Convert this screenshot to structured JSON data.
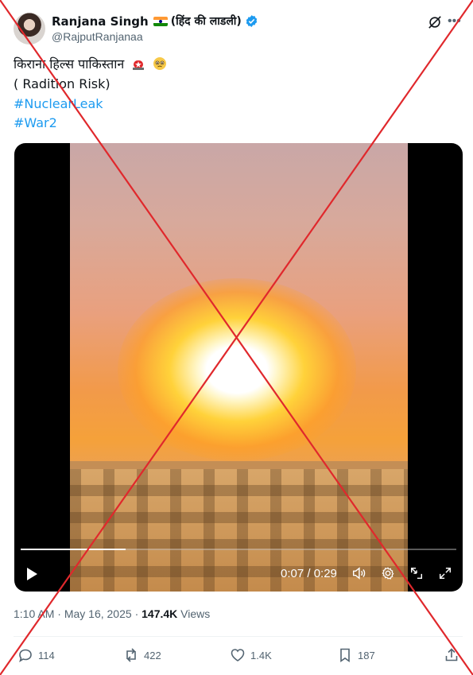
{
  "author": {
    "display_name": "Ranjana Singh",
    "name_suffix": "(हिंद की लाडली)",
    "handle": "@RajputRanjanaa",
    "verified_color": "#1d9bf0"
  },
  "post": {
    "line1": "किराना हिल्स पाकिस्तान",
    "line2": "( Radition Risk)",
    "hashtags": [
      "#NuclearLeak",
      "#War2"
    ]
  },
  "video": {
    "time_label": "0:07 / 0:29",
    "progress": 0.24
  },
  "meta": {
    "time": "1:10 AM",
    "separator": "·",
    "date": "May 16, 2025",
    "views_count": "147.4K",
    "views_label": "Views"
  },
  "actions": {
    "replies": "114",
    "reposts": "422",
    "likes": "1.4K",
    "bookmarks": "187"
  },
  "colors": {
    "link": "#1d9bf0",
    "secondary_text": "#536471",
    "overlay_cross": "#e0282c"
  }
}
